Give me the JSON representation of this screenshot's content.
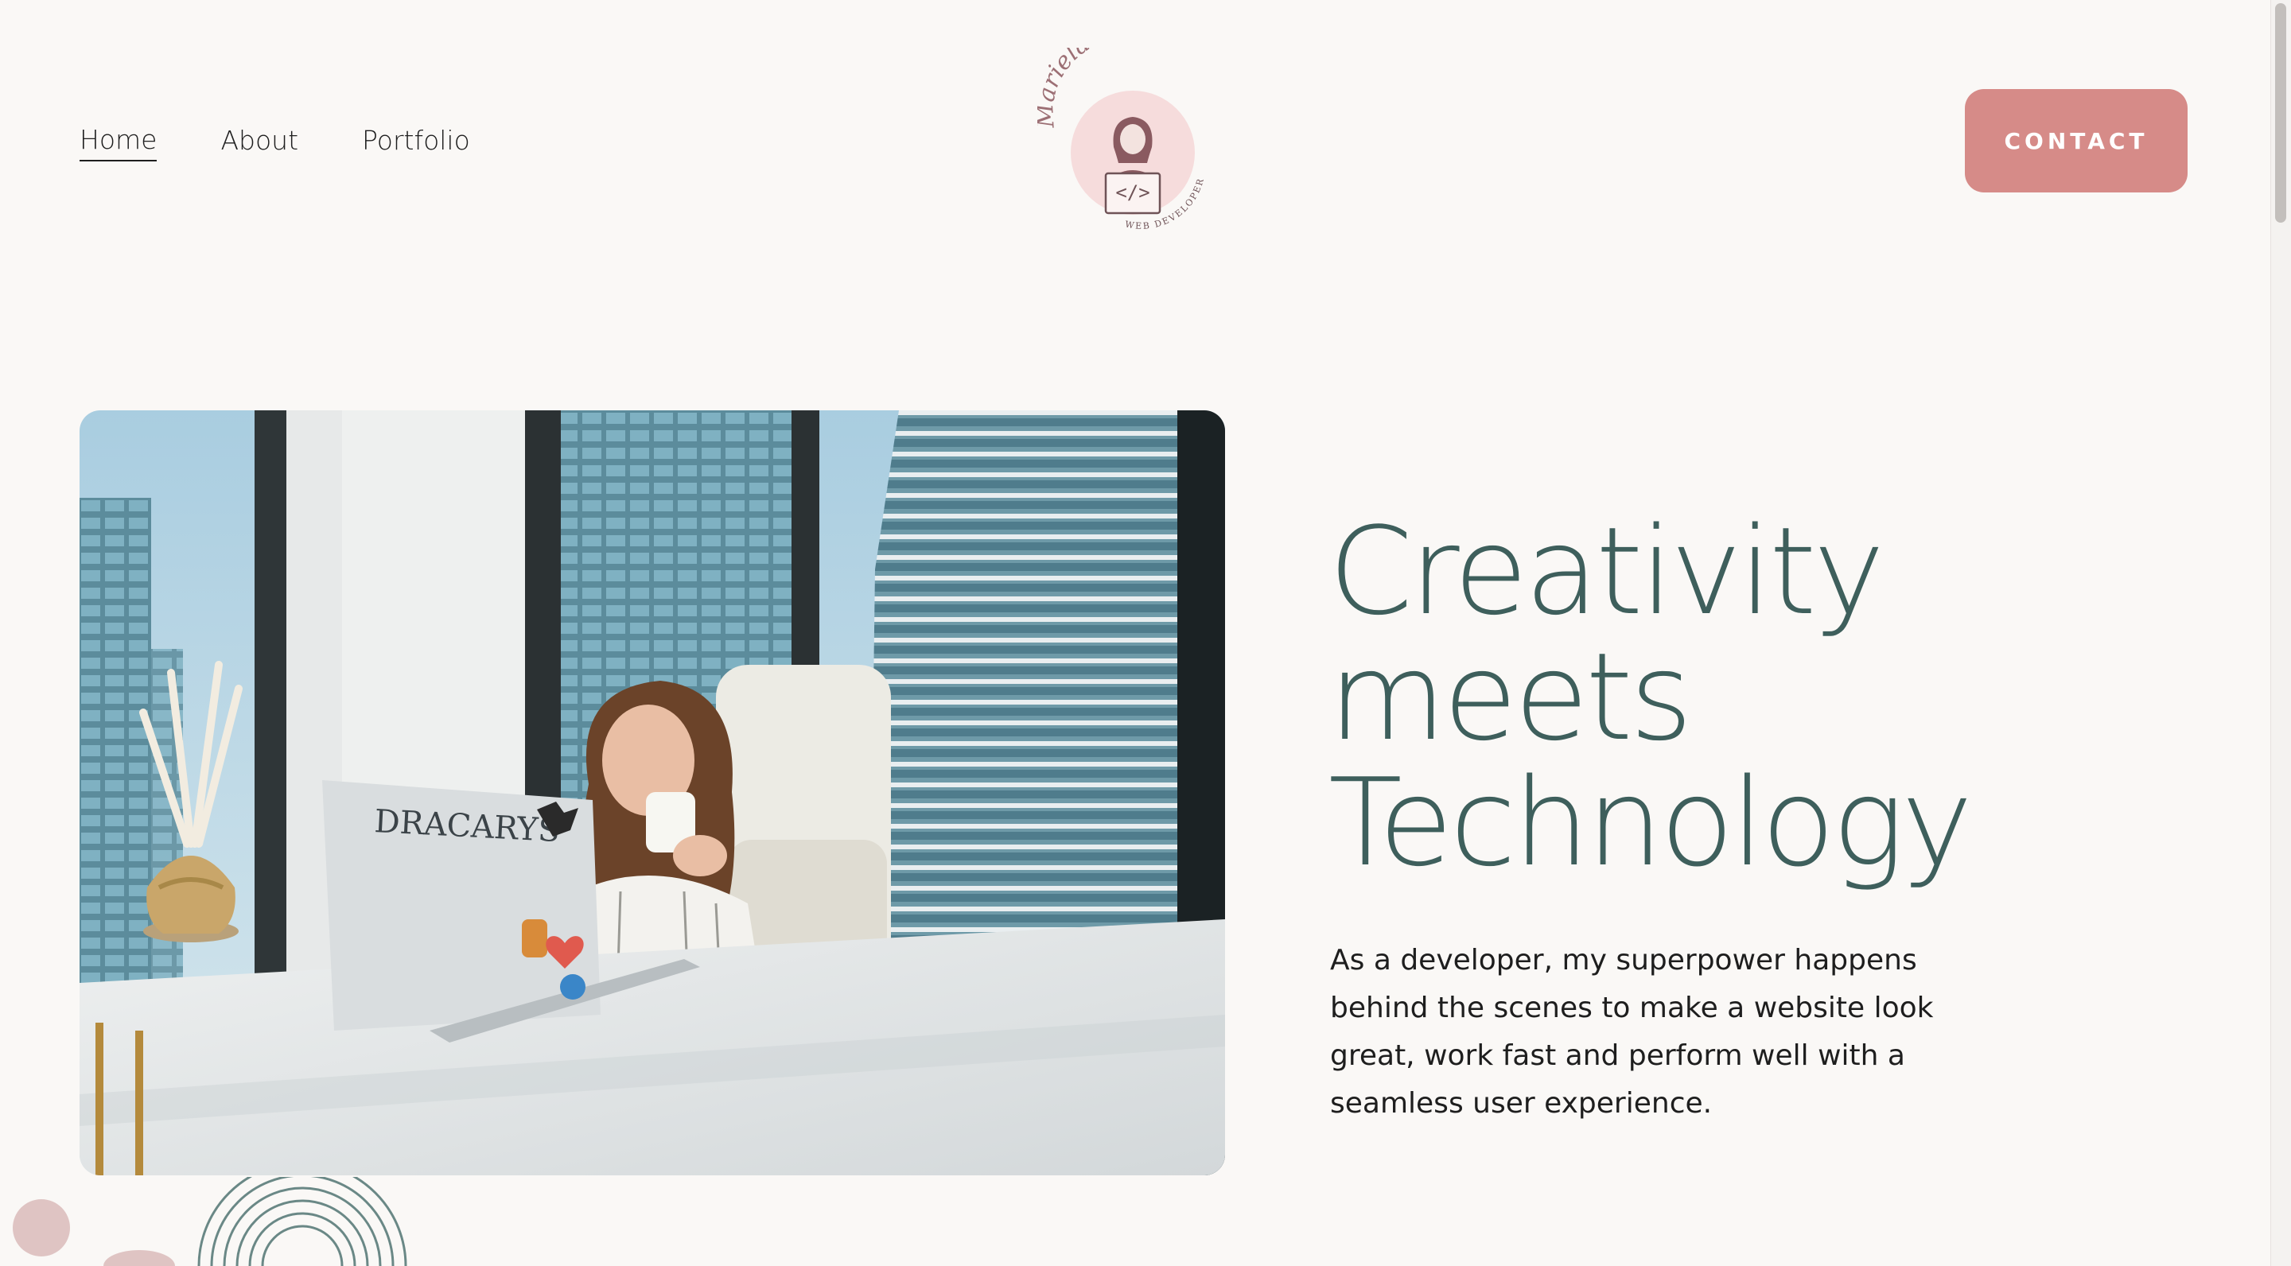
{
  "nav": {
    "items": [
      {
        "label": "Home",
        "active": true
      },
      {
        "label": "About",
        "active": false
      },
      {
        "label": "Portfolio",
        "active": false
      }
    ]
  },
  "logo": {
    "script_name": "Mariela Lopez",
    "subtitle": "WEB DEVELOPER",
    "code_symbol": "</>"
  },
  "contact_button": {
    "label": "CONTACT"
  },
  "hero": {
    "photo_icon": "woman-at-laptop-photo",
    "laptop_sticker_text": "DRACARYS",
    "headline": [
      "Creativity",
      "meets",
      "Technology"
    ],
    "description": "As a developer, my superpower happens behind the scenes to make a website look great, work fast and perform well with a seamless user experience."
  },
  "colors": {
    "background": "#faf8f6",
    "accent": "#d68b88",
    "headline": "#3e5f5c",
    "deco_pink": "#dfc4c3"
  }
}
